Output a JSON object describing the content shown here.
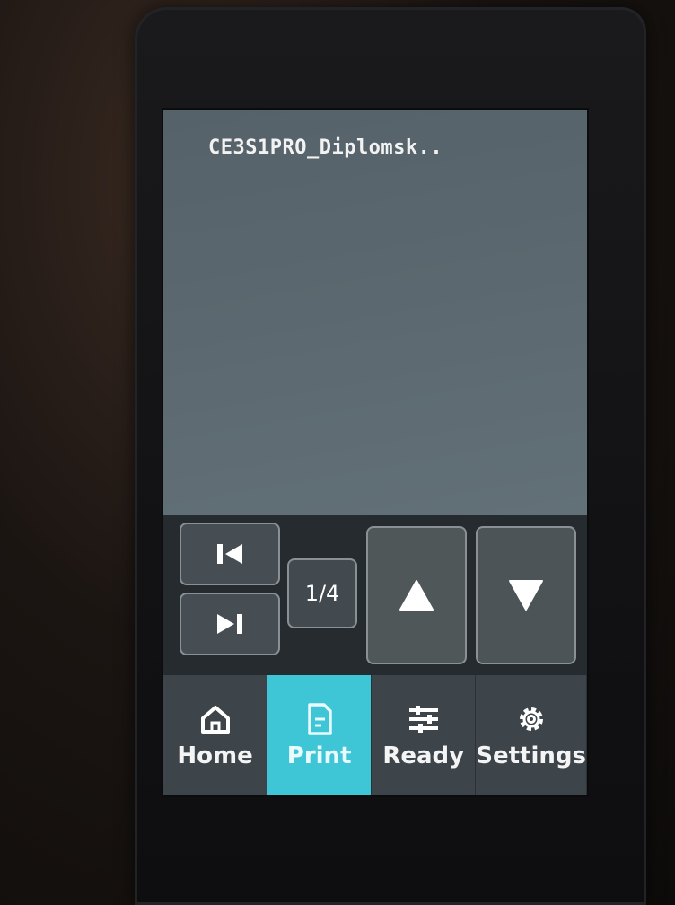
{
  "file_list": {
    "file_name": "CE3S1PRO_Diplomsk.."
  },
  "pager": {
    "page_indicator": "1/4",
    "icons": {
      "first": "skip-first-icon",
      "last": "skip-last-icon",
      "up": "triangle-up-icon",
      "down": "triangle-down-icon"
    }
  },
  "nav": {
    "tabs": [
      {
        "label": "Home",
        "icon": "home-icon",
        "active": false
      },
      {
        "label": "Print",
        "icon": "document-icon",
        "active": true
      },
      {
        "label": "Ready",
        "icon": "sliders-icon",
        "active": false
      },
      {
        "label": "Settings",
        "icon": "gear-icon",
        "active": false
      }
    ]
  },
  "colors": {
    "accent": "#3fc6d6",
    "file_area": "#5b676e",
    "nav_background": "#3e454a"
  }
}
